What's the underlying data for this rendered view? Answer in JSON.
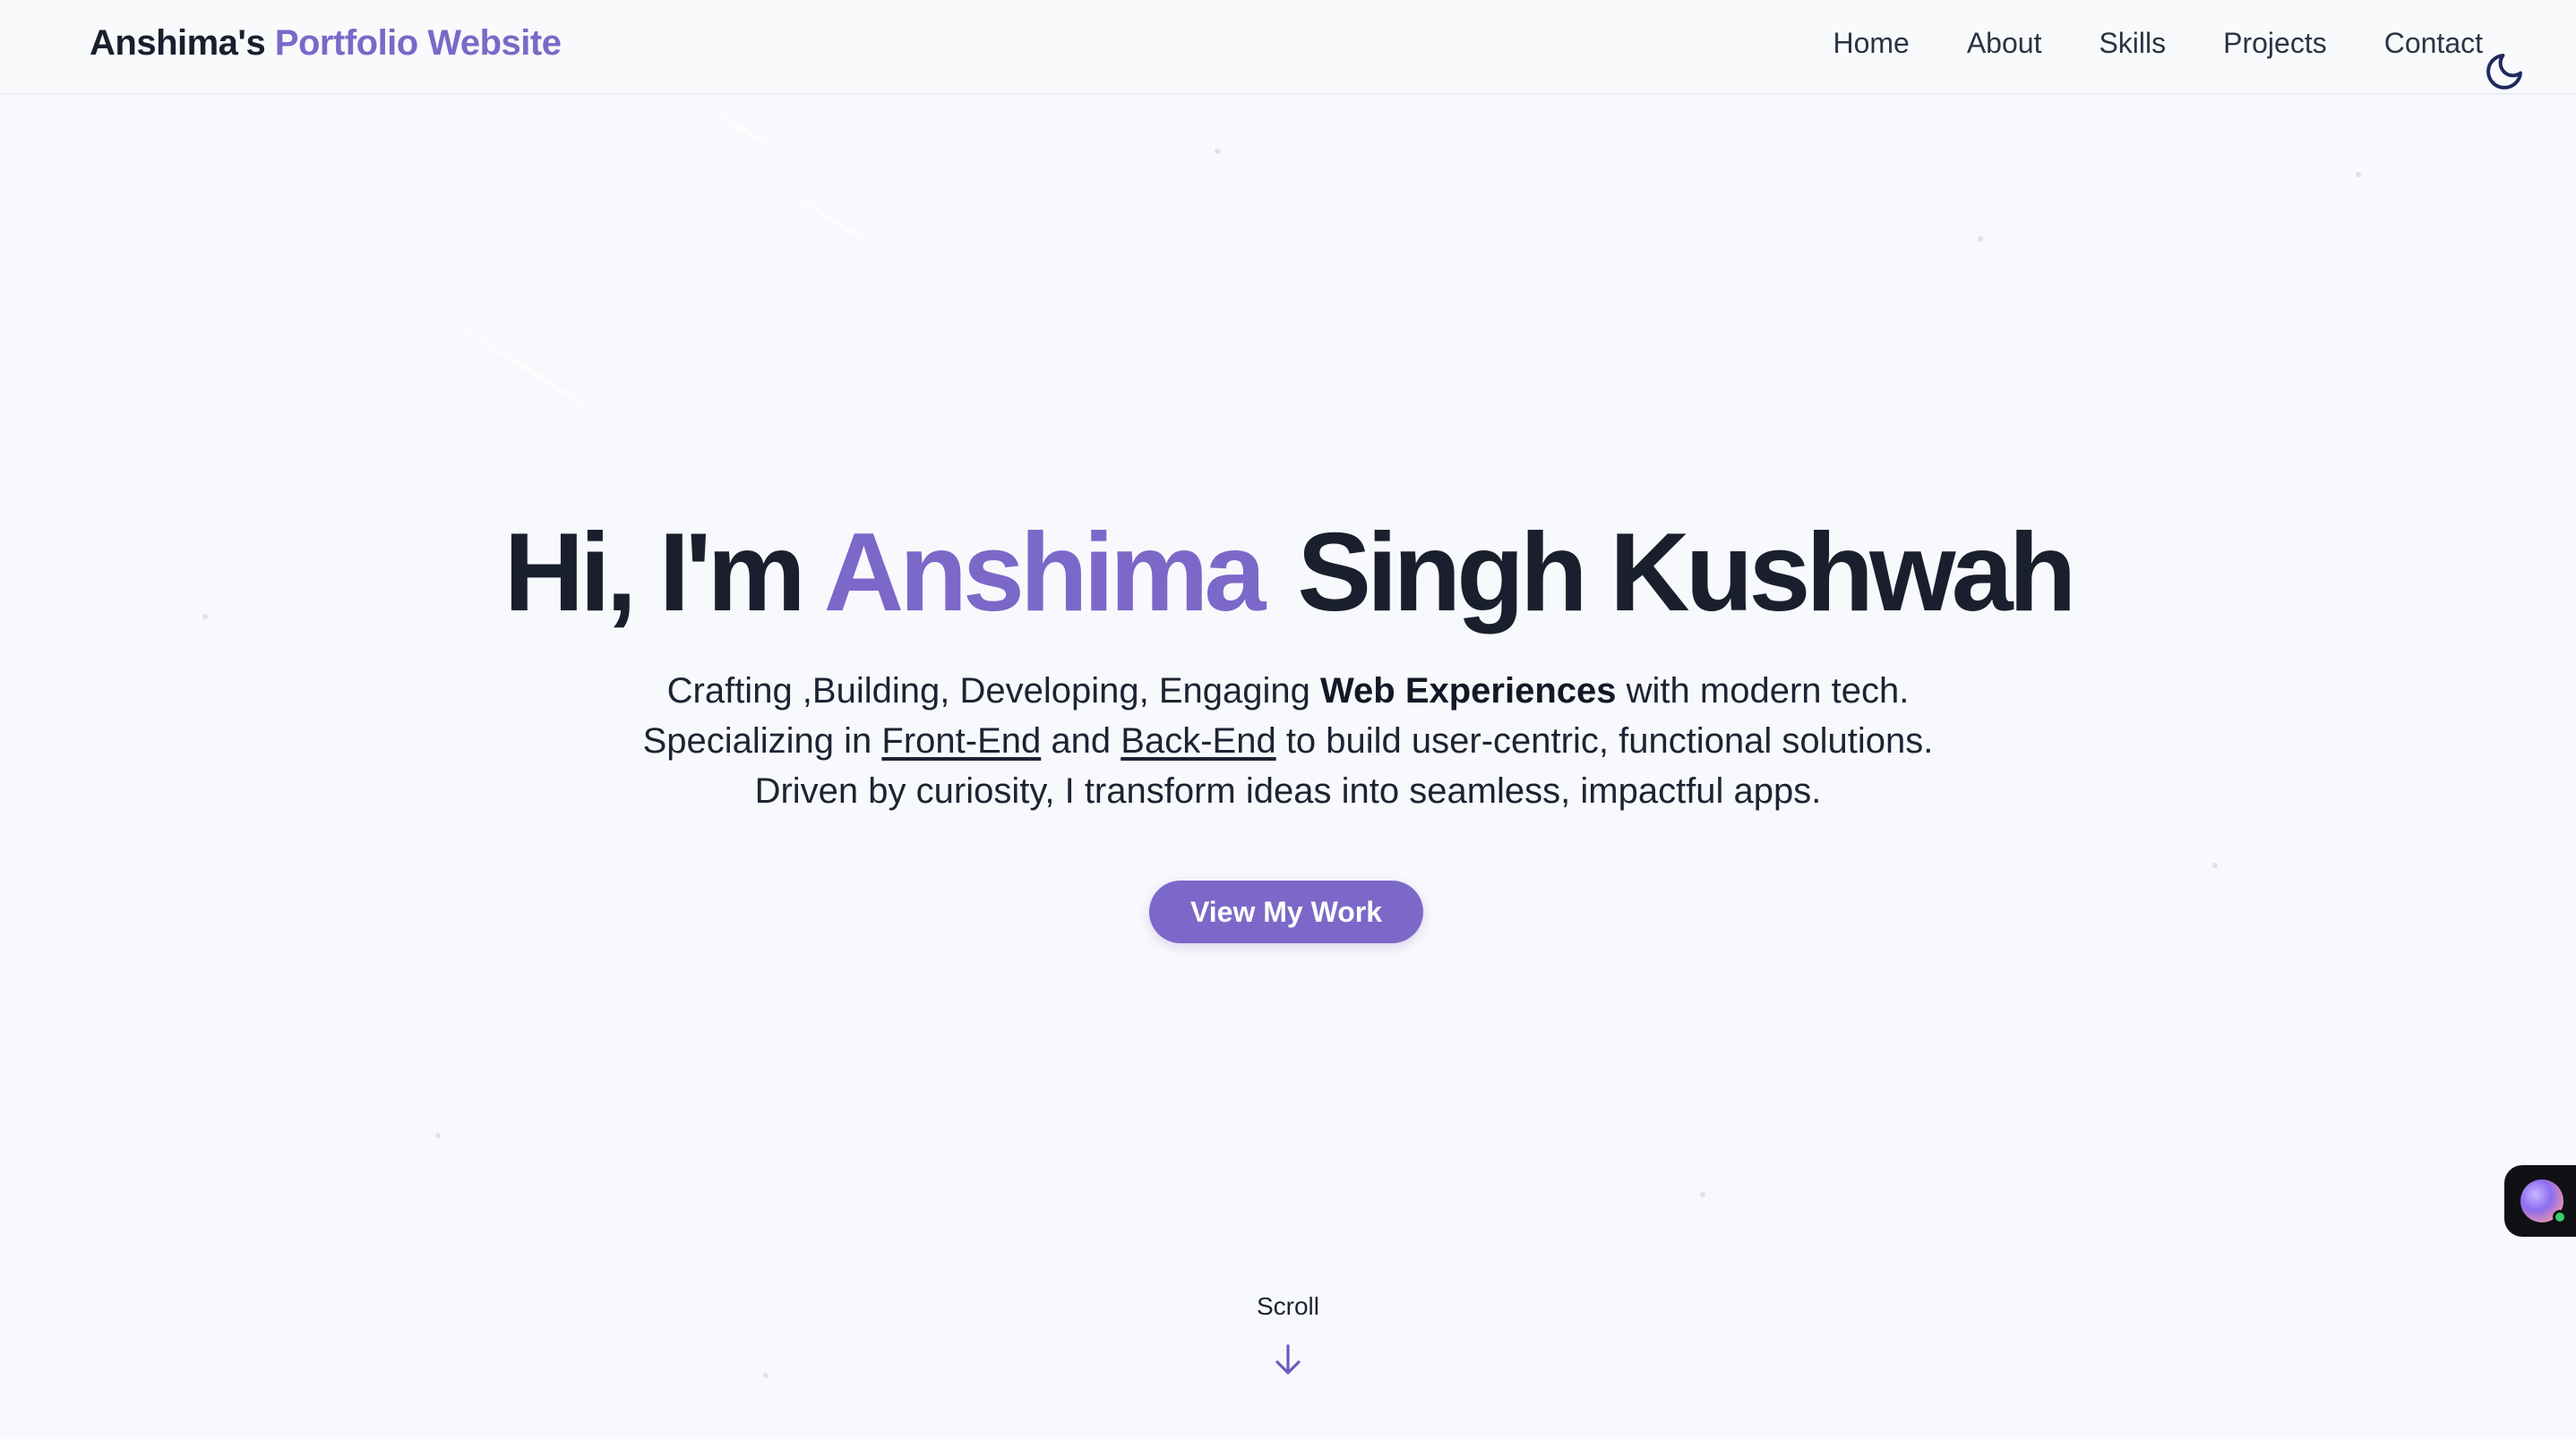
{
  "header": {
    "brand_part1": "Anshima's",
    "brand_part2": "Portfolio Website",
    "nav": [
      {
        "label": "Home"
      },
      {
        "label": "About"
      },
      {
        "label": "Skills"
      },
      {
        "label": "Projects"
      },
      {
        "label": "Contact"
      }
    ],
    "theme_toggle_icon": "moon-icon"
  },
  "hero": {
    "greeting": "Hi, I'm",
    "first_name": "Anshima",
    "last_name": "Singh Kushwah",
    "line1_pre": "Crafting ,Building, Developing, Engaging",
    "line1_bold": "Web Experiences",
    "line1_post": "with modern tech.",
    "line2_pre": "Specializing in",
    "line2_link1": "Front-End",
    "line2_mid": "and",
    "line2_link2": "Back-End",
    "line2_post": "to build user-centric, functional solutions.",
    "line3": "Driven by curiosity, I transform ideas into seamless, impactful apps.",
    "cta_label": "View My Work"
  },
  "scroll": {
    "label": "Scroll",
    "icon": "arrow-down-icon"
  },
  "chat_widget": {
    "icon": "chat-avatar-icon"
  },
  "colors": {
    "accent": "#7b68c8",
    "text": "#1a1f2e",
    "background": "#f8f9fc",
    "online": "#3ccf6e"
  }
}
